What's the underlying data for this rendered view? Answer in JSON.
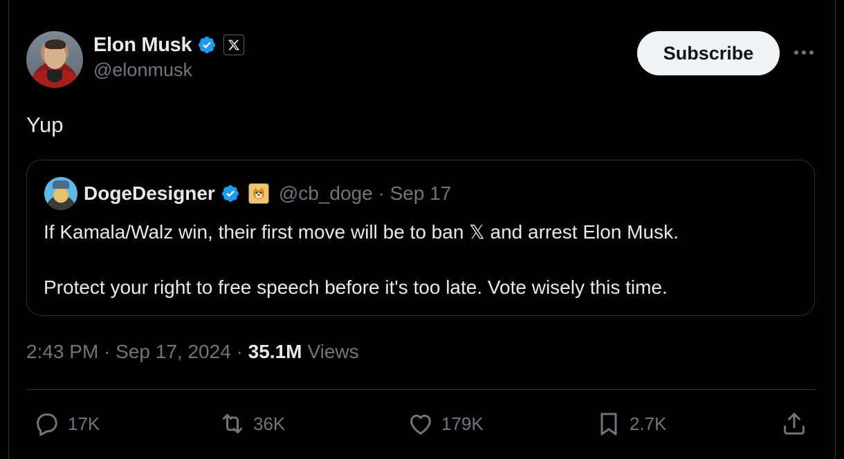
{
  "author": {
    "name": "Elon Musk",
    "handle": "@elonmusk"
  },
  "header": {
    "subscribe_label": "Subscribe"
  },
  "tweet": {
    "text": "Yup",
    "time": "2:43 PM",
    "date": "Sep 17, 2024",
    "views_count": "35.1M",
    "views_label": "Views",
    "separator": " · "
  },
  "quote": {
    "name": "DogeDesigner",
    "handle": "@cb_doge",
    "date": "Sep 17",
    "handle_date": "@cb_doge · Sep 17",
    "paragraphs": [
      "If Kamala/Walz win, their first move will be to ban 𝕏 and arrest Elon Musk.",
      "Protect your right to free speech before it's too late. Vote wisely this time."
    ]
  },
  "actions": {
    "replies": "17K",
    "reposts": "36K",
    "likes": "179K",
    "bookmarks": "2.7K"
  },
  "icons": {
    "verified": "verified-badge-icon",
    "x_badge": "x-logo-icon",
    "doge_badge": "doge-badge-icon",
    "more": "more-horizontal-icon",
    "reply": "reply-icon",
    "repost": "repost-icon",
    "like": "heart-icon",
    "bookmark": "bookmark-icon",
    "share": "share-icon"
  },
  "colors": {
    "background": "#000000",
    "text": "#e7e9ea",
    "secondary": "#71767b",
    "verified": "#1d9bf0",
    "border": "#2f3336"
  }
}
